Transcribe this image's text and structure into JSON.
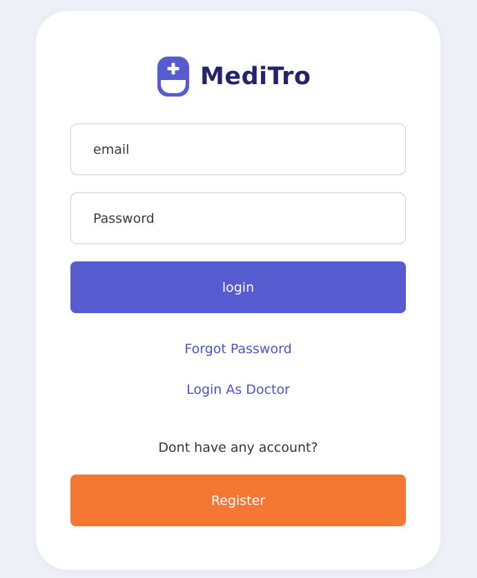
{
  "brand": {
    "name": "MediTro"
  },
  "login_form": {
    "email_placeholder": "email",
    "password_placeholder": "Password",
    "login_label": "login"
  },
  "links": {
    "forgot_password": "Forgot Password",
    "login_as_doctor": "Login As Doctor"
  },
  "register_section": {
    "prompt": "Dont have any account?",
    "register_label": "Register"
  },
  "colors": {
    "background": "#eef0f8",
    "card": "#ffffff",
    "brand_text": "#23236e",
    "logo_primary": "#565ccf",
    "primary_button": "#565ccf",
    "register_button": "#f47833",
    "link": "#4c54c4",
    "input_border": "#c9cbe8"
  },
  "icons": {
    "logo": "medical-plus-logo-icon"
  }
}
